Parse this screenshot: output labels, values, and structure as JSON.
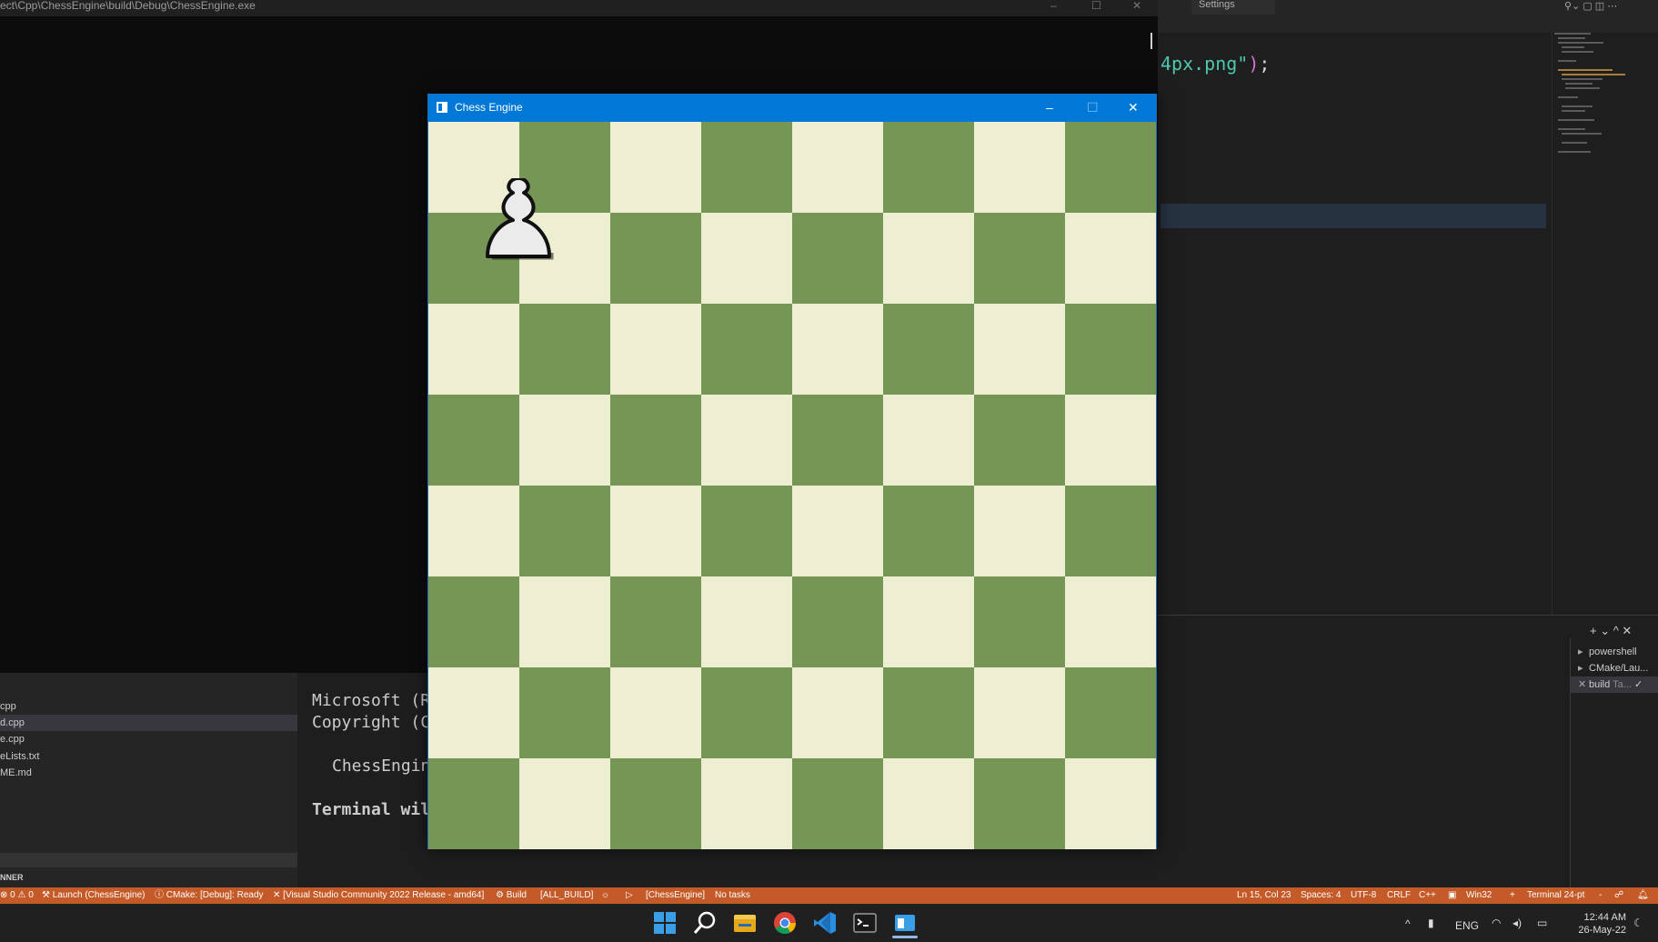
{
  "console_window": {
    "title": "ect\\Cpp\\ChessEngine\\build\\Debug\\ChessEngine.exe",
    "minimize_glyph": "–",
    "maximize_glyph": "☐",
    "close_glyph": "✕"
  },
  "editor": {
    "settings_tab_label": "Settings",
    "code_string": "4px.png\"",
    "code_paren": ")",
    "code_semi": ";"
  },
  "explorer": {
    "files": [
      {
        "name": "cpp",
        "active": false
      },
      {
        "name": "d.cpp",
        "active": true
      },
      {
        "name": "e.cpp",
        "active": false
      },
      {
        "name": "eLists.txt",
        "active": false
      },
      {
        "name": "ME.md",
        "active": false
      }
    ],
    "runner_label": "NNER"
  },
  "terminal_text": {
    "line1": "Microsoft (R",
    "line2": "Copyright (C",
    "line3": "ChessEngin",
    "line4": "Terminal wil"
  },
  "terminal_panel": {
    "actions": "+ ⌄  ^  ✕",
    "items": [
      {
        "icon": "terminal-icon",
        "label": "powershell",
        "sub": ""
      },
      {
        "icon": "terminal-icon",
        "label": "CMake/Lau...",
        "sub": ""
      },
      {
        "icon": "tools-icon",
        "label": "build",
        "sub": "Ta...",
        "check": "✓"
      }
    ]
  },
  "chess_window": {
    "title": "Chess Engine",
    "minimize_glyph": "–",
    "maximize_glyph": "☐",
    "close_glyph": "✕",
    "light_color": "#eeeed2",
    "dark_color": "#769656",
    "pieces": [
      {
        "type": "pawn",
        "color": "white",
        "square": "b8"
      }
    ]
  },
  "status_bar": {
    "problems": "⊗ 0 ⚠ 0",
    "launch": "Launch (ChessEngine)",
    "cmake": "CMake: [Debug]: Ready",
    "kit": "[Visual Studio Community 2022 Release - amd64]",
    "build": "Build",
    "target": "[ALL_BUILD]",
    "debug_glyph": "☼",
    "run_glyph": "▷",
    "launch_target": "[ChessEngine]",
    "tasks": "No tasks",
    "position": "Ln 15, Col 23",
    "spaces": "Spaces: 4",
    "encoding": "UTF-8",
    "eol": "CRLF",
    "language": "C++",
    "platform": "Win32",
    "plus": "+",
    "terminal_font": "Terminal 24-pt",
    "dash": "-"
  },
  "taskbar": {
    "language": "ENG",
    "time": "12:44 AM",
    "date": "26-May-22"
  }
}
